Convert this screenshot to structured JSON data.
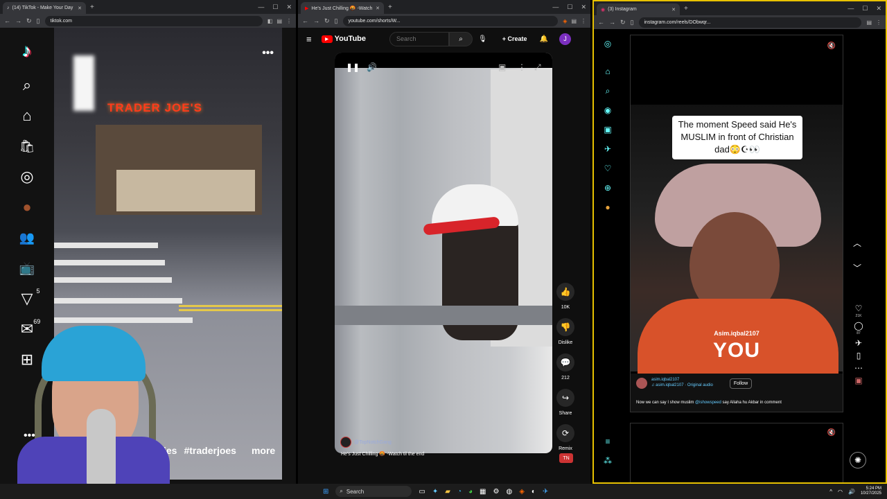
{
  "tiktok": {
    "tab_title": "(14) TikTok - Make Your Day",
    "url": "tiktok.com",
    "logo": "♪",
    "sidebar": [
      {
        "icon": "search-icon",
        "glyph": "⌕"
      },
      {
        "icon": "home-icon",
        "glyph": "⌂"
      },
      {
        "icon": "shop-icon",
        "glyph": "🛍"
      },
      {
        "icon": "explore-icon",
        "glyph": "◎"
      },
      {
        "icon": "profile-avatar",
        "glyph": "●"
      },
      {
        "icon": "following-icon",
        "glyph": "👥"
      },
      {
        "icon": "live-icon",
        "glyph": "📺"
      },
      {
        "icon": "activity-icon",
        "glyph": "▽",
        "badge": "5"
      },
      {
        "icon": "messages-icon",
        "glyph": "✉",
        "badge": "69"
      },
      {
        "icon": "upload-icon",
        "glyph": "⊞"
      }
    ],
    "sign_text": "TRADER JOE'S",
    "caption_tags": [
      "ownies",
      "#traderjoes"
    ],
    "more_label": "more",
    "menu_dots": "•••",
    "sidebar_more": "•••"
  },
  "youtube": {
    "tab_title": "He's Just Chilling 🤬 -Watch",
    "url": "youtube.com/shorts/W...",
    "logo_text": "YouTube",
    "search_placeholder": "Search",
    "create_label": "Create",
    "avatar_letter": "J",
    "likes": "10K",
    "dislike_label": "Dislike",
    "comments": "212",
    "share_label": "Share",
    "remix_label": "Remix",
    "channel": "@TopNotchGang",
    "video_title": "He's Just Chilling 🤬 -Watch til the end"
  },
  "instagram": {
    "tab_title": "(3) Instagram",
    "url": "instagram.com/reels/DObwqr...",
    "overlay_text": "The moment Speed said He's MUSLIM in front of Christian dad😳☪👀",
    "video_user": "Asim.iqbal2107",
    "video_big_text": "YOU",
    "author": "asim.iqbal2107",
    "audio": "♫ asim.iqbal2107 · Original audio",
    "follow_label": "Follow",
    "caption_prefix": "Now we can say I show muslim ",
    "caption_mention": "@ishowspeed",
    "caption_suffix": " say Allaha hu Akbar in comment",
    "likes": "21K",
    "comments": "87"
  },
  "taskbar": {
    "search_label": "Search",
    "time": "5:24 PM",
    "date": "10/27/2025"
  }
}
